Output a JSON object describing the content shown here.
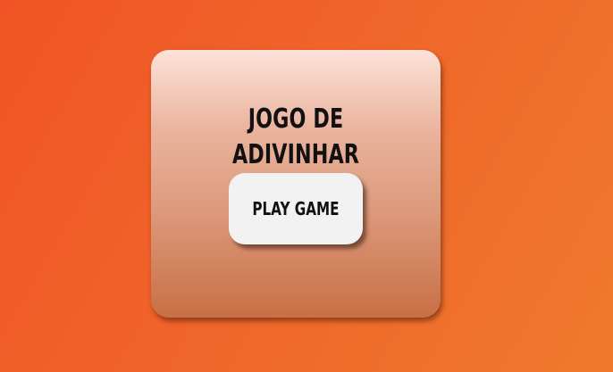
{
  "game": {
    "title": "JOGO DE ADIVINHAR",
    "play_label": "PLAY GAME"
  },
  "colors": {
    "background": "#f05a28",
    "card_top": "#fce2da",
    "card_bottom": "#c96f45",
    "button": "#f2f2f2",
    "text": "#111111"
  }
}
